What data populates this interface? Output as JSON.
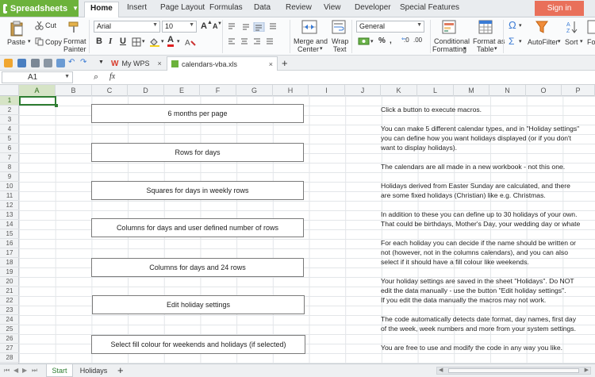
{
  "app": {
    "name": "Spreadsheets",
    "signin_label": "Sign in"
  },
  "menu": {
    "tabs": [
      "Home",
      "Insert",
      "Page Layout",
      "Formulas",
      "Data",
      "Review",
      "View",
      "Developer",
      "Special Features"
    ]
  },
  "ribbon": {
    "paste": "Paste",
    "cut": "Cut",
    "copy": "Copy",
    "format_painter_1": "Format",
    "format_painter_2": "Painter",
    "font_name": "Arial",
    "font_size": "10",
    "number_format": "General",
    "merge_1": "Merge and",
    "merge_2": "Center",
    "wrap_1": "Wrap",
    "wrap_2": "Text",
    "cond_1": "Conditional",
    "cond_2": "Formatting",
    "table_1": "Format as",
    "table_2": "Table",
    "autofilter": "AutoFilter",
    "sort": "Sort",
    "fo": "Fo",
    "bold": "B",
    "italic": "I",
    "underline": "U",
    "grow": "A",
    "shrink": "A",
    "fontcolor": "A",
    "percent": "%",
    "dec_inc": ".0",
    "dec_dec": ".00"
  },
  "doc_tabs": [
    {
      "label": "My WPS"
    },
    {
      "label": "calendars-vba.xls"
    }
  ],
  "formula_bar": {
    "name_box": "A1",
    "fx": "fx"
  },
  "columns": [
    "A",
    "B",
    "C",
    "D",
    "E",
    "F",
    "G",
    "H",
    "I",
    "J",
    "K",
    "L",
    "M",
    "N",
    "O",
    "P"
  ],
  "rows": [
    "1",
    "2",
    "3",
    "4",
    "5",
    "6",
    "7",
    "8",
    "9",
    "10",
    "11",
    "12",
    "13",
    "14",
    "15",
    "16",
    "17",
    "18",
    "19",
    "20",
    "21",
    "22",
    "23",
    "24",
    "25",
    "26",
    "27",
    "28"
  ],
  "buttons": [
    "6 months per page",
    "Rows for days",
    "Squares for days in weekly rows",
    "Columns for days and user defined number of rows",
    "Columns for days and 24 rows",
    "Edit holiday settings",
    "Select fill colour for weekends and holidays (if selected)"
  ],
  "notes": [
    "Click a button to execute macros.",
    "You can make 5 different calendar types, and in \"Holiday settings\"",
    "you can define how you want holidays displayed (or if you don't",
    "want to display holidays).",
    "The calendars are all made in a new workbook - not this one.",
    "Holidays derived from Easter Sunday are calculated, and there",
    "are some fixed holidays (Christian) like e.g. Christmas.",
    "In addition to these you can define up to 30 holidays of your own.",
    "That could be birthdays, Mother's Day, your wedding day or whate",
    "For each holiday you can decide if the name should be written or",
    "not (however, not in the columns calendars), and you can also",
    "select if it should have a fill colour like weekends.",
    "Your holiday settings are saved in the sheet \"Holidays\". Do NOT",
    "edit the data manually - use the button \"Edit holiday settings\".",
    "If you edit the data manually the macros may not work.",
    "The code automatically detects date format, day names, first day",
    "of the week, week numbers and more from your system settings.",
    "You are free to use and modify the code in any way you like."
  ],
  "sheets": [
    "Start",
    "Holidays"
  ],
  "add_sheet": "+",
  "colors": {
    "accent": "#6cb23b",
    "signin": "#e9705a",
    "selection": "#2e7d32"
  }
}
